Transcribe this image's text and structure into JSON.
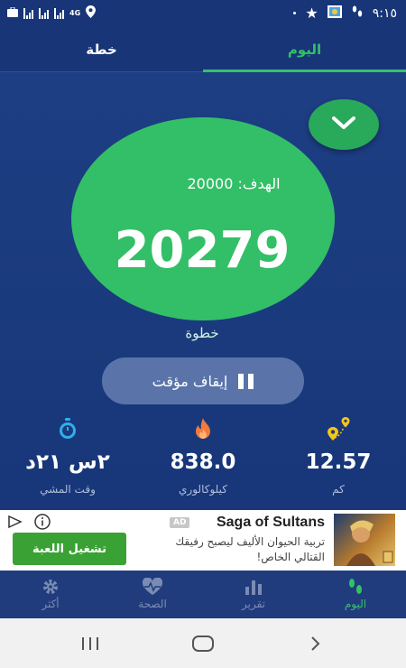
{
  "status_bar": {
    "network": "4G",
    "time": "٩:١٥"
  },
  "tabs": {
    "today": "اليوم",
    "plan": "خطة"
  },
  "progress": {
    "goal_text": "الهدف: 20000",
    "steps": "20279",
    "steps_unit": "خطوة"
  },
  "controls": {
    "pause_label": "إيقاف مؤقت"
  },
  "stats": {
    "distance": {
      "value": "12.57",
      "label": "كم",
      "icon": "location-pin-icon"
    },
    "calories": {
      "value": "838.0",
      "label": "كيلوكالوري",
      "icon": "flame-icon"
    },
    "walk_time": {
      "value": "٢س ٢١د",
      "label": "وقت المشي",
      "icon": "stopwatch-icon"
    }
  },
  "ad": {
    "title": "Saga of Sultans",
    "badge": "AD",
    "description": "تربية الحيوان الأليف ليصبح رفيقك القتالي الخاص!",
    "cta": "تشغيل اللعبة"
  },
  "bottom_nav": {
    "today": "اليوم",
    "report": "تقرير",
    "health": "الصحة",
    "more": "أكثر"
  },
  "colors": {
    "background": "#173577",
    "accent_green": "#33c167",
    "pause_button": "#5a74a9"
  }
}
